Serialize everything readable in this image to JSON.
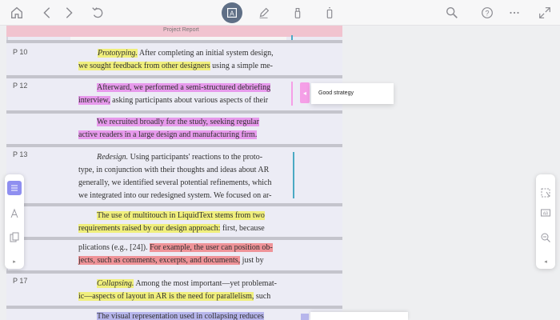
{
  "toolbar": {
    "left_icons": [
      "home-icon",
      "back-icon",
      "forward-icon",
      "undo-icon"
    ],
    "center_icons": [
      "text-select-icon",
      "pen-icon",
      "highlighter-icon",
      "eraser-icon"
    ],
    "right_icons": [
      "search-icon",
      "help-icon",
      "more-icon",
      "expand-icon"
    ]
  },
  "document": {
    "header": "Project Report",
    "pages": [
      "P 10",
      "P 12",
      "P 13",
      "P 17"
    ],
    "p10": {
      "line1_em": "Prototyping.",
      "line1_rest": " After completing an initial system design,",
      "line2_hl": "we sought feedback from other designers",
      "line2_rest": " using a simple me-"
    },
    "p12a": {
      "line1_hl": "Afterward, we performed a semi-structured debriefing",
      "line2_hl": "interview,",
      "line2_rest": " asking participants about various aspects of their"
    },
    "p12b": {
      "line1_hl": "We recruited broadly for the study, seeking regular",
      "line2_hl": "active readers in a large design and manufacturing firm."
    },
    "p13": {
      "line1_em": "Redesign.",
      "line1_rest": " Using participants' reactions to the proto-",
      "line2": "type, in conjunction with their thoughts and ideas about AR",
      "line3": "generally, we identified several potential refinements, which",
      "line4": "we integrated into our redesigned system. We focused on ar-"
    },
    "p13b": {
      "line1_hl": "The use of multitouch in LiquidText stems from two",
      "line2_hl": "requirements raised by our design approach:",
      "line2_rest": " first, because"
    },
    "p13c": {
      "line1_pre": "plications (e.g., [24]). ",
      "line1_hl": "For example, the user can position ob-",
      "line2_hl": "jects, such as comments, excerpts, and documents,",
      "line2_rest": " just by"
    },
    "p17": {
      "line1_em": "Collapsing.",
      "line1_rest": " Among the most important—yet problemat-",
      "line2_hl": "ic—aspects of layout in AR is the need for parallelism,",
      "line2_rest": " such",
      "line3_hl": "The visual representation used in collapsing reduces"
    }
  },
  "comment": {
    "text": "Good strategy",
    "color": "#f59fe7"
  },
  "left_panel": {
    "icons": [
      "note-icon",
      "text-style-icon",
      "document-copy-icon"
    ],
    "chevron": "▸"
  },
  "right_panel": {
    "icons": [
      "select-area-icon",
      "text-box-icon",
      "zoom-out-icon"
    ],
    "chevron": "◂"
  },
  "colors": {
    "yellow": "#f0ef7c",
    "pink": "#e79aec",
    "red": "#ef9398",
    "blue": "#b7b6ec",
    "teal": "#4ba9c4",
    "accent": "#5f6f86"
  }
}
